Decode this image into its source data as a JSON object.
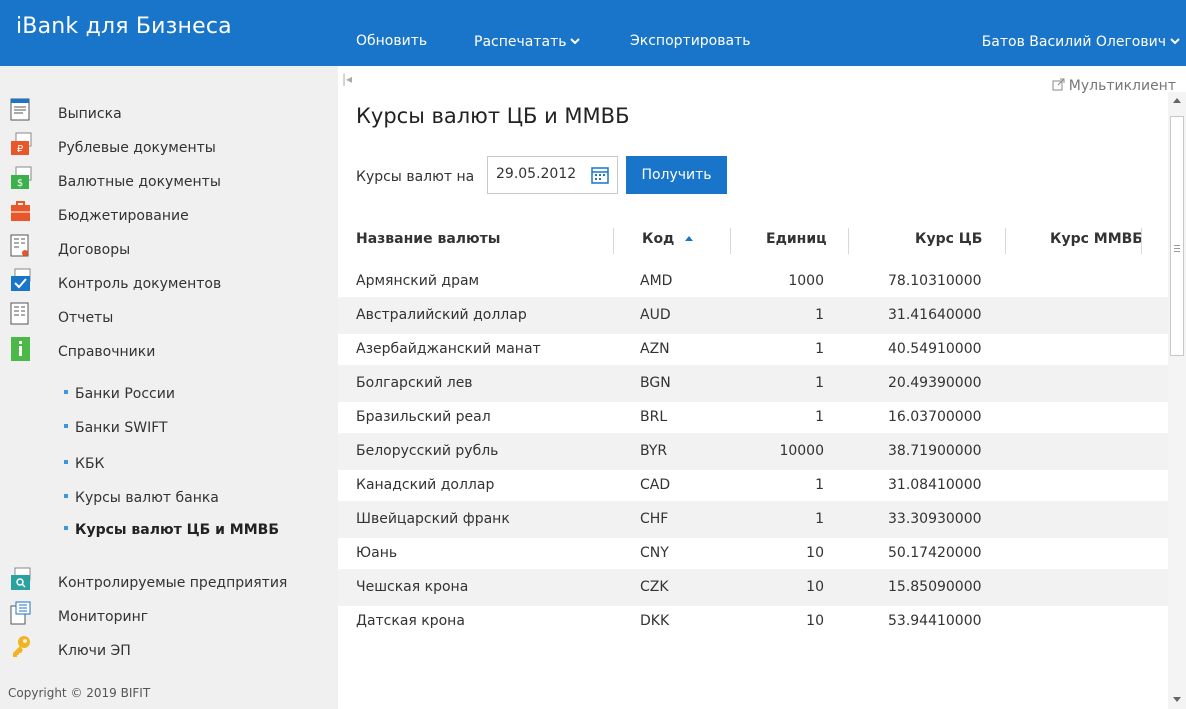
{
  "header": {
    "brand": "iBank для Бизнеса",
    "menu": {
      "refresh": "Обновить",
      "print": "Распечатать",
      "export": "Экспортировать"
    },
    "user": "Батов Василий Олегович"
  },
  "sidebar": {
    "items": [
      {
        "label": "Выписка",
        "icon": "statement-icon"
      },
      {
        "label": "Рублевые документы",
        "icon": "ruble-documents-icon"
      },
      {
        "label": "Валютные документы",
        "icon": "currency-documents-icon"
      },
      {
        "label": "Бюджетирование",
        "icon": "budget-icon"
      },
      {
        "label": "Договоры",
        "icon": "contracts-icon"
      },
      {
        "label": "Контроль документов",
        "icon": "document-control-icon"
      },
      {
        "label": "Отчеты",
        "icon": "reports-icon"
      },
      {
        "label": "Справочники",
        "icon": "directories-icon"
      }
    ],
    "sub_items": [
      {
        "label": "Банки России"
      },
      {
        "label": "Банки SWIFT"
      },
      {
        "label": "КБК"
      },
      {
        "label": "Курсы валют банка"
      },
      {
        "label": "Курсы валют ЦБ и ММВБ",
        "active": true
      }
    ],
    "bottom_items": [
      {
        "label": "Контролируемые предприятия",
        "icon": "controlled-enterprises-icon"
      },
      {
        "label": "Мониторинг",
        "icon": "monitoring-icon"
      },
      {
        "label": "Ключи ЭП",
        "icon": "key-icon"
      }
    ],
    "copyright": "Copyright © 2019 BIFIT"
  },
  "main": {
    "multiclient": "Мультиклиент",
    "title": "Курсы валют ЦБ и ММВБ",
    "filter_label": "Курсы валют на",
    "date_value": "29.05.2012",
    "get_button": "Получить",
    "columns": {
      "name": "Название валюты",
      "code": "Код",
      "units": "Единиц",
      "cb_rate": "Курс ЦБ",
      "mmvb_rate": "Курс ММВБ"
    },
    "rows": [
      {
        "name": "Армянский драм",
        "code": "AMD",
        "units": "1000",
        "cb_rate": "78.10310000",
        "mmvb_rate": ""
      },
      {
        "name": "Австралийский доллар",
        "code": "AUD",
        "units": "1",
        "cb_rate": "31.41640000",
        "mmvb_rate": ""
      },
      {
        "name": "Азербайджанский манат",
        "code": "AZN",
        "units": "1",
        "cb_rate": "40.54910000",
        "mmvb_rate": ""
      },
      {
        "name": "Болгарский лев",
        "code": "BGN",
        "units": "1",
        "cb_rate": "20.49390000",
        "mmvb_rate": ""
      },
      {
        "name": "Бразильский реал",
        "code": "BRL",
        "units": "1",
        "cb_rate": "16.03700000",
        "mmvb_rate": ""
      },
      {
        "name": "Белорусский рубль",
        "code": "BYR",
        "units": "10000",
        "cb_rate": "38.71900000",
        "mmvb_rate": ""
      },
      {
        "name": "Канадский доллар",
        "code": "CAD",
        "units": "1",
        "cb_rate": "31.08410000",
        "mmvb_rate": ""
      },
      {
        "name": "Швейцарский франк",
        "code": "CHF",
        "units": "1",
        "cb_rate": "33.30930000",
        "mmvb_rate": ""
      },
      {
        "name": "Юань",
        "code": "CNY",
        "units": "10",
        "cb_rate": "50.17420000",
        "mmvb_rate": ""
      },
      {
        "name": "Чешская крона",
        "code": "CZK",
        "units": "10",
        "cb_rate": "15.85090000",
        "mmvb_rate": ""
      },
      {
        "name": "Датская крона",
        "code": "DKK",
        "units": "10",
        "cb_rate": "53.94410000",
        "mmvb_rate": ""
      }
    ]
  },
  "colors": {
    "brand_blue": "#1875c9",
    "sidebar_bg": "#f0f0f0",
    "row_alt": "#f2f2f2",
    "bullet": "#3a96e0"
  }
}
